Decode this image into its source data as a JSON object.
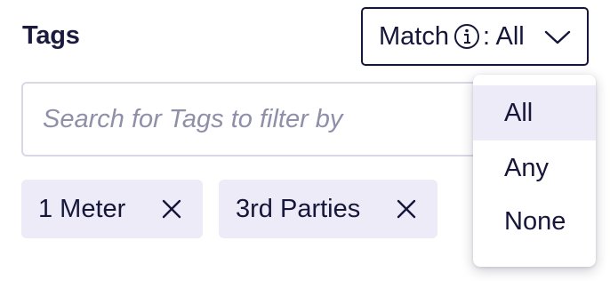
{
  "title": "Tags",
  "match": {
    "label": "Match",
    "suffix": ": All",
    "info_icon": "info-circle-icon",
    "chevron_icon": "chevron-down-icon"
  },
  "search": {
    "placeholder": "Search for Tags to filter by",
    "icon": "none"
  },
  "tags": [
    {
      "label": "1 Meter",
      "remove_icon": "close-icon"
    },
    {
      "label": "3rd Parties",
      "remove_icon": "close-icon"
    }
  ],
  "dropdown": {
    "options": [
      "All",
      "Any",
      "None"
    ],
    "selected": "All"
  },
  "colors": {
    "text": "#15163a",
    "chip_bg": "#ecebf7",
    "border": "#d9d9e6",
    "placeholder": "#8e8fa8"
  }
}
